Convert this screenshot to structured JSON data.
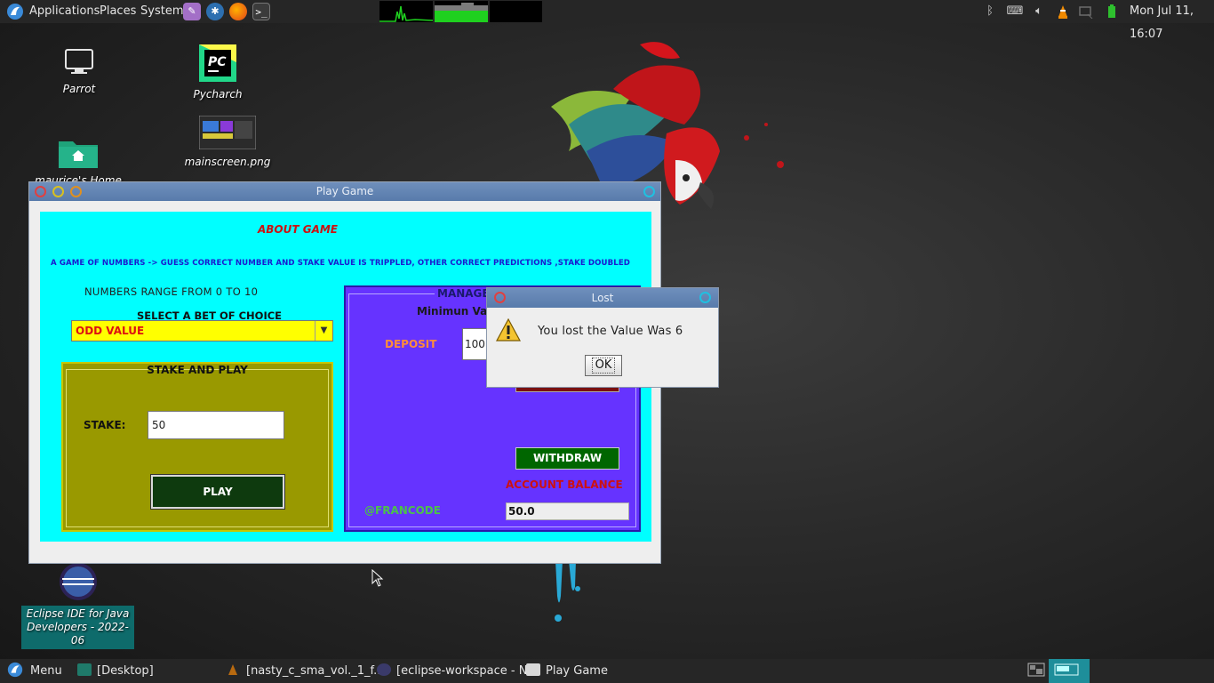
{
  "top_panel": {
    "menus": [
      "Applications",
      "Places",
      "System"
    ],
    "launchers": [
      "text-editor-icon",
      "settings-icon",
      "firefox-icon",
      "terminal-icon"
    ],
    "clock": "Mon Jul 11, 16:07"
  },
  "desktop": {
    "icons": [
      {
        "name": "parrot-computer-icon",
        "label": "Parrot"
      },
      {
        "name": "pycharm-icon",
        "label": "Pycharch"
      },
      {
        "name": "home-folder-icon",
        "label": "maurice's Home"
      },
      {
        "name": "image-file-icon",
        "label": "mainscreen.png"
      },
      {
        "name": "eclipse-icon",
        "label": "Eclipse IDE for Java Developers - 2022-06"
      }
    ]
  },
  "play_game": {
    "title": "Play Game",
    "about_title": "ABOUT GAME",
    "about_text": "A GAME OF NUMBERS -> GUESS CORRECT NUMBER AND STAKE VALUE IS TRIPPLED, OTHER CORRECT PREDICTIONS ,STAKE DOUBLED",
    "range_label": "NUMBERS RANGE FROM 0 TO 10",
    "select_label": "SELECT A BET OF CHOICE",
    "bet_choice": "ODD VALUE",
    "stake_panel_title": "STAKE AND PLAY",
    "stake_label": "STAKE:",
    "stake_value": "50",
    "play_label": "PLAY",
    "manage_title": "MANAGE",
    "min_label": "Minimun Va",
    "deposit_label": "DEPOSIT",
    "deposit_value": "100",
    "withdraw_label": "WITHDRAW",
    "balance_label": "ACCOUNT BALANCE",
    "francode": "@FRANCODE",
    "balance_value": "50.0"
  },
  "dialog": {
    "title": "Lost",
    "message": "You lost the Value Was 6",
    "ok_label": "OK"
  },
  "taskbar": {
    "menu_label": "Menu",
    "tasks": [
      {
        "label": "[Desktop]"
      },
      {
        "label": "[nasty_c_sma_vol._1_f..."
      },
      {
        "label": "[eclipse-workspace - N..."
      },
      {
        "label": "Play Game"
      }
    ]
  },
  "colors": {
    "panel_bg": "#262626",
    "content_bg": "#00ffff",
    "stake_panel": "#999900",
    "manage_panel": "#6633ff",
    "combo_bg": "#ffff00",
    "titlebar": "#6a8bbd"
  }
}
